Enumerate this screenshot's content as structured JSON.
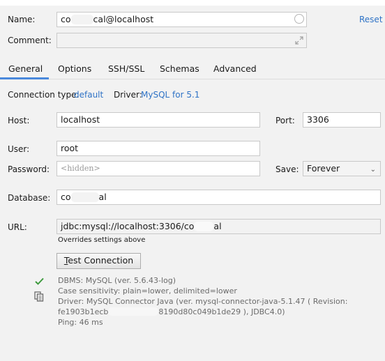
{
  "name": {
    "label": "Name:",
    "value_prefix": "co",
    "value_suffix": "cal@localhost"
  },
  "reset_label": "Reset",
  "comment": {
    "label": "Comment:",
    "value": ""
  },
  "tabs": [
    {
      "label": "General",
      "active": true
    },
    {
      "label": "Options",
      "active": false
    },
    {
      "label": "SSH/SSL",
      "active": false
    },
    {
      "label": "Schemas",
      "active": false
    },
    {
      "label": "Advanced",
      "active": false
    }
  ],
  "connection": {
    "type_label": "Connection type:",
    "type_value": "default",
    "driver_label": "Driver:",
    "driver_value": "MySQL for 5.1"
  },
  "host": {
    "label": "Host:",
    "value": "localhost"
  },
  "port": {
    "label": "Port:",
    "value": "3306"
  },
  "user": {
    "label": "User:",
    "value": "root"
  },
  "password": {
    "label": "Password:",
    "placeholder": "<hidden>"
  },
  "save": {
    "label": "Save:",
    "value": "Forever"
  },
  "database": {
    "label": "Database:",
    "value_prefix": "co",
    "value_suffix": "al"
  },
  "url": {
    "label": "URL:",
    "value_prefix": "jdbc:mysql://localhost:3306/co",
    "value_suffix": "al",
    "note": "Overrides settings above"
  },
  "test_button": {
    "mnemonic": "T",
    "rest": "est Connection"
  },
  "results": {
    "dbms": "DBMS: MySQL (ver. 5.6.43-log)",
    "case": "Case sensitivity: plain=lower, delimited=lower",
    "driver": "Driver: MySQL Connector Java (ver. mysql-connector-java-5.1.47 ( Revision:",
    "revision_prefix": "fe1903b1ecb",
    "revision_suffix": "8190d80c049b1de29 ), JDBC4.0)",
    "ping": "Ping: 46 ms"
  },
  "colors": {
    "accent": "#2f73c6",
    "success": "#3d9a3d",
    "tab_underline": "#4a89dc"
  }
}
